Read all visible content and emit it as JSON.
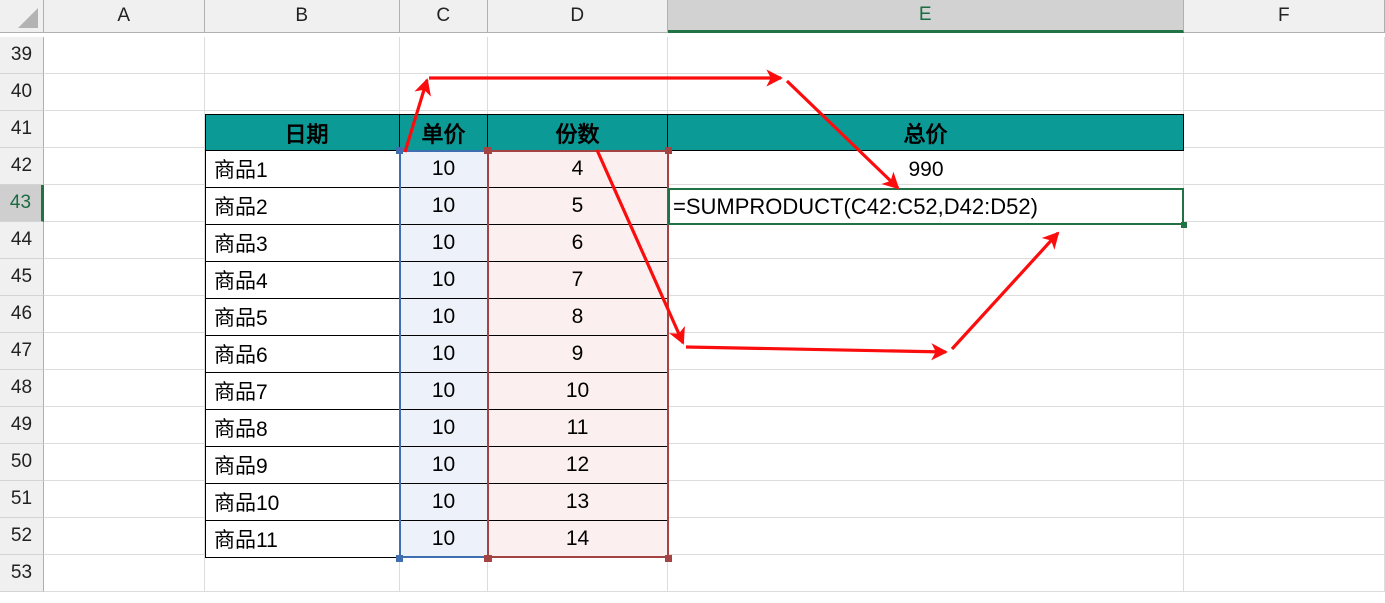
{
  "app": {
    "type": "spreadsheet"
  },
  "grid": {
    "corner_name": "select-all-corner",
    "columns": [
      {
        "label": "A",
        "selected": false
      },
      {
        "label": "B",
        "selected": false
      },
      {
        "label": "C",
        "selected": false
      },
      {
        "label": "D",
        "selected": false
      },
      {
        "label": "E",
        "selected": true
      },
      {
        "label": "F",
        "selected": false
      }
    ],
    "rows": [
      {
        "label": "39",
        "selected": false
      },
      {
        "label": "40",
        "selected": false
      },
      {
        "label": "41",
        "selected": false
      },
      {
        "label": "42",
        "selected": false
      },
      {
        "label": "43",
        "selected": true
      },
      {
        "label": "44",
        "selected": false
      },
      {
        "label": "45",
        "selected": false
      },
      {
        "label": "46",
        "selected": false
      },
      {
        "label": "47",
        "selected": false
      },
      {
        "label": "48",
        "selected": false
      },
      {
        "label": "49",
        "selected": false
      },
      {
        "label": "50",
        "selected": false
      },
      {
        "label": "51",
        "selected": false
      },
      {
        "label": "52",
        "selected": false
      },
      {
        "label": "53",
        "selected": false
      }
    ]
  },
  "table": {
    "headers": {
      "date": "日期",
      "unit_price": "单价",
      "quantity": "份数",
      "total_price": "总价"
    },
    "rows": [
      {
        "name": "商品1",
        "unit_price": "10",
        "quantity": "4"
      },
      {
        "name": "商品2",
        "unit_price": "10",
        "quantity": "5"
      },
      {
        "name": "商品3",
        "unit_price": "10",
        "quantity": "6"
      },
      {
        "name": "商品4",
        "unit_price": "10",
        "quantity": "7"
      },
      {
        "name": "商品5",
        "unit_price": "10",
        "quantity": "8"
      },
      {
        "name": "商品6",
        "unit_price": "10",
        "quantity": "9"
      },
      {
        "name": "商品7",
        "unit_price": "10",
        "quantity": "10"
      },
      {
        "name": "商品8",
        "unit_price": "10",
        "quantity": "11"
      },
      {
        "name": "商品9",
        "unit_price": "10",
        "quantity": "12"
      },
      {
        "name": "商品10",
        "unit_price": "10",
        "quantity": "13"
      },
      {
        "name": "商品11",
        "unit_price": "10",
        "quantity": "14"
      }
    ]
  },
  "cells": {
    "E42_value": "990",
    "E43_formula": "=SUMPRODUCT(C42:C52,D42:D52)"
  },
  "annotations": {
    "arrow_color": "#fc0d0d",
    "arrow_1_name": "arrow-unitprice-range-to-formula",
    "arrow_2_name": "arrow-quantity-range-to-formula"
  },
  "colors": {
    "header_teal": "#0c9a96",
    "unit_price_fill": "#edf2fa",
    "quantity_fill": "#fcefef",
    "unit_price_border": "#3f6fb0",
    "quantity_border": "#a34343",
    "active_border": "#217346",
    "arrow_red": "#fc0d0d"
  }
}
